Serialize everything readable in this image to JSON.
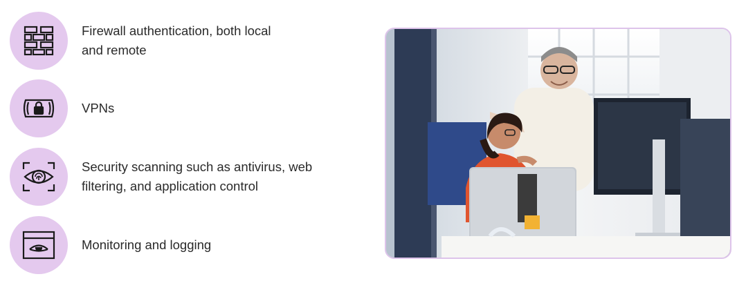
{
  "features": [
    {
      "icon": "firewall-brick-wall-icon",
      "lines": [
        "Firewall authentication, both local",
        "and remote"
      ]
    },
    {
      "icon": "vpn-lock-tunnel-icon",
      "lines": [
        "VPNs"
      ]
    },
    {
      "icon": "eye-scan-fingerprint-icon",
      "lines": [
        "Security scanning such as antivirus, web",
        "filtering, and application control"
      ]
    },
    {
      "icon": "monitor-eye-window-icon",
      "lines": [
        "Monitoring and logging"
      ]
    }
  ],
  "photo": {
    "description_icon": "office-workers-photo-icon"
  },
  "colors": {
    "badge": "#e4c9ee",
    "frame_border": "#ddc3ea",
    "text": "#2a2a2a"
  }
}
